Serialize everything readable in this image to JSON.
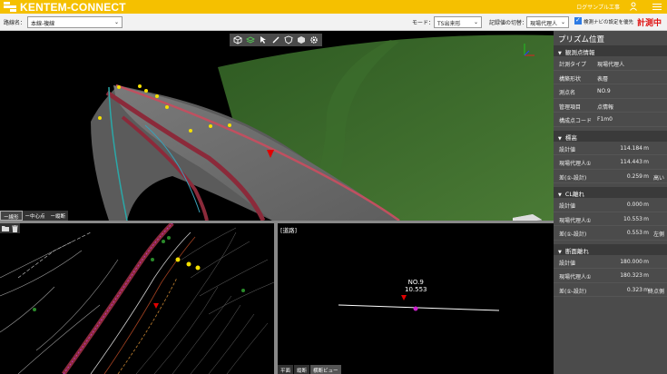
{
  "header": {
    "logo_text": "KENTEM-CONNECT",
    "user_name": "ログサンプル工事",
    "user_icon": "person-icon",
    "menu_icon": "hamburger-menu-icon"
  },
  "toolbar": {
    "route_label": "路線名：",
    "route_value": "本線-複線",
    "mode_label": "モード：",
    "mode_value": "TS出来形",
    "record_label": "記録値の切替：",
    "record_value": "現場代理人",
    "navi_label": "検測ナビの設定を優先",
    "status": "計測中"
  },
  "view3d": {
    "tool_icons": [
      "box-view-icon",
      "layers-icon",
      "pointer-icon",
      "pencil-icon",
      "shield-icon",
      "cube-icon",
      "gear-icon"
    ],
    "modes": [
      "ー線形",
      "ー中心点",
      "ー縦断"
    ],
    "cube_label": "西"
  },
  "plan": {
    "tools": [
      "folder-icon",
      "trash-icon"
    ]
  },
  "cross": {
    "title": "[道路]",
    "station_name": "NO.9",
    "station_value": "10.553",
    "tabs": [
      "平面",
      "縦断",
      "横断ビュー"
    ]
  },
  "panel": {
    "title": "プリズム位置",
    "sections": [
      {
        "title": "観測点情報",
        "rows": [
          {
            "k": "計測タイプ",
            "v": "現場代理人"
          },
          {
            "k": "構築形状",
            "v": "表層"
          },
          {
            "k": "測点名",
            "v": "NO.9"
          },
          {
            "k": "管理項目",
            "v": "点情報"
          },
          {
            "k": "構成点コード",
            "v": "F1m0"
          }
        ]
      },
      {
        "title": "標高",
        "rows": [
          {
            "k": "設計値",
            "n": "114.184",
            "u": "m",
            "x": ""
          },
          {
            "k": "現場代理人①",
            "n": "114.443",
            "u": "m",
            "x": ""
          },
          {
            "k": "差(①-設計)",
            "n": "0.259",
            "u": "m",
            "x": "高い"
          }
        ]
      },
      {
        "title": "CL離れ",
        "rows": [
          {
            "k": "設計値",
            "n": "0.000",
            "u": "m",
            "x": ""
          },
          {
            "k": "現場代理人①",
            "n": "10.553",
            "u": "m",
            "x": ""
          },
          {
            "k": "差(①-設計)",
            "n": "0.553",
            "u": "m",
            "x": "左側"
          }
        ]
      },
      {
        "title": "断面離れ",
        "rows": [
          {
            "k": "設計値",
            "n": "180.000",
            "u": "m",
            "x": ""
          },
          {
            "k": "現場代理人①",
            "n": "180.323",
            "u": "m",
            "x": ""
          },
          {
            "k": "差(①-設計)",
            "n": "0.323",
            "u": "m",
            "x": "終点側"
          }
        ]
      }
    ]
  },
  "colors": {
    "brand": "#f5c000",
    "status_red": "#e01010",
    "terrain_green": "#3a6a2a"
  }
}
